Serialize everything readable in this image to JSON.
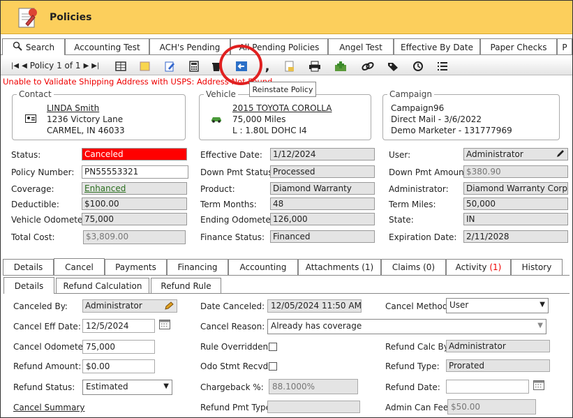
{
  "header": {
    "title": "Policies"
  },
  "top_tabs": [
    "Search",
    "Accounting Test",
    "ACH's Pending",
    "All Pending Policies",
    "Angel Test",
    "Effective By Date",
    "Paper Checks",
    "P"
  ],
  "pager": {
    "text": "Policy 1 of 1"
  },
  "tooltip": "Reinstate Policy",
  "warning": "Unable to Validate Shipping Address with USPS: Address Not Found",
  "contact": {
    "legend": "Contact",
    "name": "LINDA Smith",
    "line1": "1236 Victory Lane",
    "line2": "CARMEL, IN 46033"
  },
  "vehicle": {
    "legend": "Vehicle",
    "name": "2015 TOYOTA COROLLA",
    "line1": "75,000 Miles",
    "line2": "L : 1.80L DOHC I4"
  },
  "campaign": {
    "legend": "Campaign",
    "line0": "Campaign96",
    "line1": "Direct Mail - 3/6/2022",
    "line2": "Demo Marketer - 131777969"
  },
  "col1": {
    "status_label": "Status:",
    "status": "Canceled",
    "policy_label": "Policy Number:",
    "policy": "PN55553321",
    "coverage_label": "Coverage:",
    "coverage": "Enhanced",
    "deductible_label": "Deductible:",
    "deductible": "$100.00",
    "odometer_label": "Vehicle Odometer:",
    "odometer": "75,000",
    "total_label": "Total Cost:",
    "total": "$3,809.00"
  },
  "col2": {
    "eff_label": "Effective Date:",
    "eff": "1/12/2024",
    "dps_label": "Down Pmt Status:",
    "dps": "Processed",
    "product_label": "Product:",
    "product": "Diamond Warranty",
    "term_label": "Term Months:",
    "term": "48",
    "endodo_label": "Ending Odometer:",
    "endodo": "126,000",
    "finance_label": "Finance Status:",
    "finance": "Financed"
  },
  "col3": {
    "user_label": "User:",
    "user": "Administrator",
    "dpa_label": "Down Pmt Amount:",
    "dpa": "$380.90",
    "admin_label": "Administrator:",
    "admin": "Diamond Warranty Corp.",
    "miles_label": "Term Miles:",
    "miles": "50,000",
    "state_label": "State:",
    "state": "IN",
    "exp_label": "Expiration Date:",
    "exp": "2/11/2028"
  },
  "bottom_tabs": [
    "Details",
    "Cancel",
    "Payments",
    "Financing",
    "Accounting",
    "Attachments (1)",
    "Claims (0)",
    "Activity",
    "History"
  ],
  "activity_count": "(1)",
  "sub_tabs": [
    "Details",
    "Refund Calculation",
    "Refund Rule"
  ],
  "cancel": {
    "by_label": "Canceled By:",
    "by": "Administrator",
    "eff_label": "Cancel Eff Date:",
    "eff": "12/5/2024",
    "odo_label": "Cancel Odometer:",
    "odo": "75,000",
    "amt_label": "Refund Amount:",
    "amt": "$0.00",
    "rstatus_label": "Refund Status:",
    "rstatus": "Estimated",
    "summary": "Cancel Summary",
    "date_label": "Date Canceled:",
    "date": "12/05/2024 11:50 AM",
    "reason_label": "Cancel Reason:",
    "reason": "Already has coverage",
    "override_label": "Rule Overridden:",
    "odostmt_label": "Odo Stmt Recvd:",
    "charge_label": "Chargeback %:",
    "charge": "88.1000%",
    "rpt_label": "Refund Pmt Type:",
    "rpt": "",
    "method_label": "Cancel Method:",
    "method": "User",
    "calcby_label": "Refund Calc By:",
    "calcby": "Administrator",
    "rtype_label": "Refund Type:",
    "rtype": "Prorated",
    "rdate_label": "Refund Date:",
    "rdate": "",
    "fee_label": "Admin Can Fee:",
    "fee": "$50.00"
  }
}
